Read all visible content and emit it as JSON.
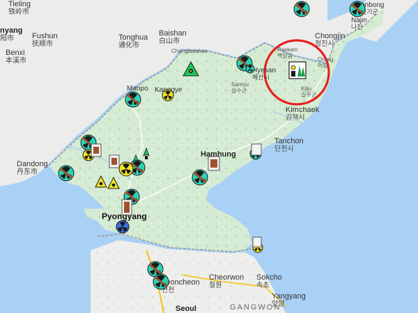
{
  "map": {
    "colors": {
      "water": "#a9d0f5",
      "land_north": "#d4ead2",
      "land_south": "#eeeeee",
      "land_china": "#ececec",
      "border": "#8e8e8e",
      "highlight_ring": "#e8201f",
      "marker_teal": "#2bd3b6",
      "marker_yellow": "#f5e324",
      "marker_brown": "#a0522d"
    },
    "labels": {
      "tieling": {
        "en": "Tieling",
        "ko": "铁岭市"
      },
      "shenyang": {
        "en": "nyang",
        "ko": "阳市"
      },
      "fushun": {
        "en": "Fushun",
        "ko": "抚顺市"
      },
      "benxi": {
        "en": "Benxi",
        "ko": "本溪市"
      },
      "tonghua": {
        "en": "Tonghua",
        "ko": "通化市"
      },
      "baishan": {
        "en": "Baishan",
        "ko": "白山市"
      },
      "changbaishan": {
        "en": "Changbaishan",
        "ko": ""
      },
      "manpo": {
        "en": "Manpo",
        "ko": ""
      },
      "kanggye": {
        "en": "Kanggye",
        "ko": ""
      },
      "hyesan": {
        "en": "Hyesan",
        "ko": "혜산시"
      },
      "samsu": {
        "en": "Samsu",
        "ko": "삼수군"
      },
      "chongjin": {
        "en": "Chongjin",
        "ko": "청진시"
      },
      "najin": {
        "en": "Najin",
        "ko": "나진"
      },
      "hunchun": {
        "en": "onbong",
        "ko": "웅기군"
      },
      "paekam": {
        "en": "Paekam",
        "ko": "백암읍"
      },
      "kilju": {
        "en": "Kilju",
        "ko": "길주군"
      },
      "orang": {
        "en": "Orang",
        "ko": "어랑"
      },
      "kimchaek": {
        "en": "Kimchaek",
        "ko": "김책시"
      },
      "tanchon": {
        "en": "Tanchon",
        "ko": "단천시"
      },
      "hamhung": {
        "en": "Hamhung",
        "ko": ""
      },
      "dandong": {
        "en": "Dandong",
        "ko": "丹东市"
      },
      "pyongyang": {
        "en": "Pyongyang",
        "ko": ""
      },
      "yeoncheon": {
        "en": "Yeoncheon",
        "ko": "연천"
      },
      "cheorwon": {
        "en": "Cheorwon",
        "ko": "철원"
      },
      "sokcho": {
        "en": "Sokcho",
        "ko": "속초"
      },
      "yangyang": {
        "en": "Yangyang",
        "ko": "양양"
      },
      "seoul": {
        "en": "Seoul",
        "ko": ""
      },
      "gangwon": {
        "en": "GANGWON",
        "ko": ""
      }
    },
    "marker_icons": [
      "nuclear-missile-site-icon",
      "radiation-facility-icon",
      "test-site-icon",
      "mine-icon",
      "nuclear-plant-icon"
    ]
  }
}
